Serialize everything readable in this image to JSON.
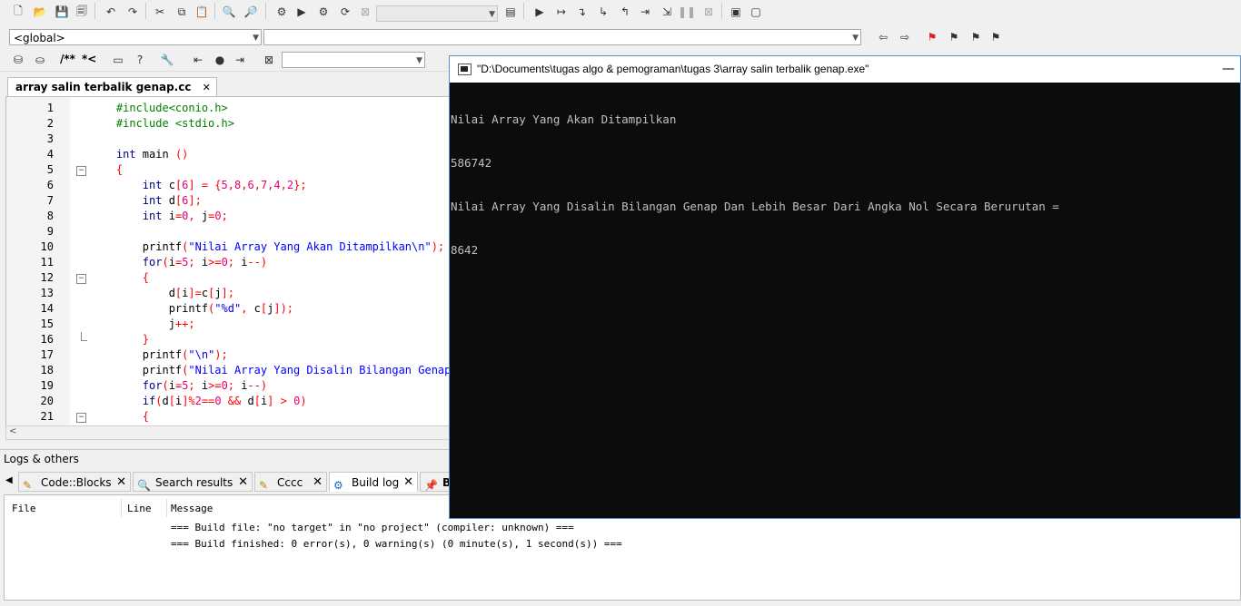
{
  "toolbar2": {
    "scope_value": "<global>",
    "symbol_value": ""
  },
  "toolbar3": {
    "comment_block": "/**",
    "comment_line": "*<"
  },
  "editor": {
    "tab_label": "array salin terbalik genap.cc",
    "tab_close": "✕",
    "lines": [
      {
        "n": "1",
        "parts": [
          [
            "pp",
            "    #include<conio.h>"
          ]
        ]
      },
      {
        "n": "2",
        "parts": [
          [
            "pp",
            "    #include <stdio.h>"
          ]
        ]
      },
      {
        "n": "3",
        "parts": [
          [
            "",
            "    "
          ]
        ]
      },
      {
        "n": "4",
        "parts": [
          [
            "kw",
            "    int"
          ],
          [
            "",
            " main "
          ],
          [
            "op",
            "()"
          ]
        ]
      },
      {
        "n": "5",
        "parts": [
          [
            "op",
            "    {"
          ]
        ]
      },
      {
        "n": "6",
        "parts": [
          [
            "kw",
            "        int"
          ],
          [
            "",
            " c"
          ],
          [
            "op",
            "["
          ],
          [
            "num",
            "6"
          ],
          [
            "op",
            "] = {"
          ],
          [
            "num",
            "5"
          ],
          [
            "op",
            ","
          ],
          [
            "num",
            "8"
          ],
          [
            "op",
            ","
          ],
          [
            "num",
            "6"
          ],
          [
            "op",
            ","
          ],
          [
            "num",
            "7"
          ],
          [
            "op",
            ","
          ],
          [
            "num",
            "4"
          ],
          [
            "op",
            ","
          ],
          [
            "num",
            "2"
          ],
          [
            "op",
            "};"
          ]
        ]
      },
      {
        "n": "7",
        "parts": [
          [
            "kw",
            "        int"
          ],
          [
            "",
            " d"
          ],
          [
            "op",
            "["
          ],
          [
            "num",
            "6"
          ],
          [
            "op",
            "];"
          ]
        ]
      },
      {
        "n": "8",
        "parts": [
          [
            "kw",
            "        int"
          ],
          [
            "",
            " i"
          ],
          [
            "op",
            "="
          ],
          [
            "num",
            "0"
          ],
          [
            "op",
            ","
          ],
          [
            "",
            " j"
          ],
          [
            "op",
            "="
          ],
          [
            "num",
            "0"
          ],
          [
            "op",
            ";"
          ]
        ]
      },
      {
        "n": "9",
        "parts": [
          [
            "",
            ""
          ]
        ]
      },
      {
        "n": "10",
        "parts": [
          [
            "",
            "        printf"
          ],
          [
            "op",
            "("
          ],
          [
            "str",
            "\"Nilai Array Yang Akan Ditampilkan\\n\""
          ],
          [
            "op",
            ");"
          ]
        ]
      },
      {
        "n": "11",
        "parts": [
          [
            "kw",
            "        for"
          ],
          [
            "op",
            "("
          ],
          [
            "",
            "i"
          ],
          [
            "op",
            "="
          ],
          [
            "num",
            "5"
          ],
          [
            "op",
            ";"
          ],
          [
            "",
            " i"
          ],
          [
            "op",
            ">="
          ],
          [
            "num",
            "0"
          ],
          [
            "op",
            ";"
          ],
          [
            "",
            " i"
          ],
          [
            "op",
            "--)"
          ]
        ]
      },
      {
        "n": "12",
        "parts": [
          [
            "op",
            "        {"
          ]
        ]
      },
      {
        "n": "13",
        "parts": [
          [
            "",
            "            d"
          ],
          [
            "op",
            "["
          ],
          [
            "",
            "i"
          ],
          [
            "op",
            "]="
          ],
          [
            "",
            "c"
          ],
          [
            "op",
            "["
          ],
          [
            "",
            "j"
          ],
          [
            "op",
            "];"
          ]
        ]
      },
      {
        "n": "14",
        "parts": [
          [
            "",
            "            printf"
          ],
          [
            "op",
            "("
          ],
          [
            "str",
            "\"%d\""
          ],
          [
            "op",
            ","
          ],
          [
            "",
            " c"
          ],
          [
            "op",
            "["
          ],
          [
            "",
            "j"
          ],
          [
            "op",
            "]);"
          ]
        ]
      },
      {
        "n": "15",
        "parts": [
          [
            "",
            "            j"
          ],
          [
            "op",
            "++;"
          ]
        ]
      },
      {
        "n": "16",
        "parts": [
          [
            "op",
            "        }"
          ]
        ]
      },
      {
        "n": "17",
        "parts": [
          [
            "",
            "        printf"
          ],
          [
            "op",
            "("
          ],
          [
            "str",
            "\"\\n\""
          ],
          [
            "op",
            ");"
          ]
        ]
      },
      {
        "n": "18",
        "parts": [
          [
            "",
            "        printf"
          ],
          [
            "op",
            "("
          ],
          [
            "str",
            "\"Nilai Array Yang Disalin Bilangan Genap"
          ]
        ]
      },
      {
        "n": "19",
        "parts": [
          [
            "kw",
            "        for"
          ],
          [
            "op",
            "("
          ],
          [
            "",
            "i"
          ],
          [
            "op",
            "="
          ],
          [
            "num",
            "5"
          ],
          [
            "op",
            ";"
          ],
          [
            "",
            " i"
          ],
          [
            "op",
            ">="
          ],
          [
            "num",
            "0"
          ],
          [
            "op",
            ";"
          ],
          [
            "",
            " i"
          ],
          [
            "op",
            "--)"
          ]
        ]
      },
      {
        "n": "20",
        "parts": [
          [
            "kw",
            "        if"
          ],
          [
            "op",
            "("
          ],
          [
            "",
            "d"
          ],
          [
            "op",
            "["
          ],
          [
            "",
            "i"
          ],
          [
            "op",
            "]%"
          ],
          [
            "num",
            "2"
          ],
          [
            "op",
            "=="
          ],
          [
            "num",
            "0"
          ],
          [
            "",
            " "
          ],
          [
            "op",
            "&&"
          ],
          [
            "",
            " d"
          ],
          [
            "op",
            "["
          ],
          [
            "",
            "i"
          ],
          [
            "op",
            "] > "
          ],
          [
            "num",
            "0"
          ],
          [
            "op",
            ")"
          ]
        ]
      },
      {
        "n": "21",
        "parts": [
          [
            "op",
            "        {"
          ]
        ]
      }
    ]
  },
  "logs": {
    "header": "Logs & others",
    "tabs": [
      {
        "label": "Code::Blocks",
        "close": "✕"
      },
      {
        "label": "Search results",
        "close": "✕"
      },
      {
        "label": "Cccc",
        "close": "✕"
      },
      {
        "label": "Build log",
        "close": "✕"
      },
      {
        "label": "B",
        "close": ""
      }
    ],
    "columns": {
      "file": "File",
      "line": "Line",
      "message": "Message"
    },
    "messages": [
      "=== Build file: \"no target\" in \"no project\" (compiler: unknown) ===",
      "=== Build finished: 0 error(s), 0 warning(s) (0 minute(s), 1 second(s)) ==="
    ]
  },
  "console": {
    "title": "\"D:\\Documents\\tugas algo & pemograman\\tugas 3\\array salin terbalik genap.exe\"",
    "minimize": "—",
    "output": [
      "Nilai Array Yang Akan Ditampilkan",
      "586742",
      "Nilai Array Yang Disalin Bilangan Genap Dan Lebih Besar Dari Angka Nol Secara Berurutan =",
      "8642"
    ]
  }
}
